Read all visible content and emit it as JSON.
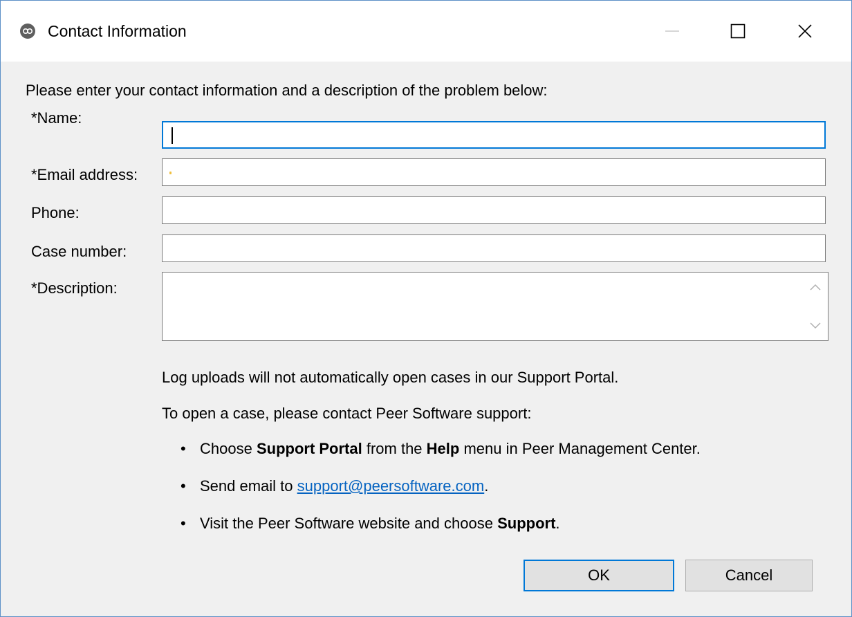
{
  "window": {
    "title": "Contact Information",
    "icon": "peer-software-app-icon",
    "controls": [
      "minimize-icon",
      "maximize-icon",
      "close-icon"
    ]
  },
  "form": {
    "prompt": "Please enter your contact information and a description of the problem below:",
    "fields": {
      "name": {
        "label": "*Name:",
        "value": ""
      },
      "email": {
        "label": "*Email address:",
        "value": ""
      },
      "phone": {
        "label": "Phone:",
        "value": ""
      },
      "case_number": {
        "label": "Case number:",
        "value": ""
      },
      "description": {
        "label": "*Description:",
        "value": ""
      }
    }
  },
  "info": {
    "line1": "Log uploads will not automatically open cases in our Support Portal.",
    "line2": "To open a case, please contact Peer Software support:",
    "bullet1": {
      "pre": "Choose ",
      "bold1": "Support Portal",
      "mid": " from the ",
      "bold2": "Help",
      "post": " menu in Peer Management Center."
    },
    "bullet2": {
      "pre": "Send email to ",
      "link": "support@peersoftware.com",
      "post": "."
    },
    "bullet3": {
      "pre": "Visit the Peer Software website and choose ",
      "bold": "Support",
      "post": "."
    }
  },
  "buttons": {
    "ok": "OK",
    "cancel": "Cancel"
  },
  "colors": {
    "accent": "#0078d7",
    "link": "#0563c1",
    "dialog_bg": "#f0f0f0"
  }
}
